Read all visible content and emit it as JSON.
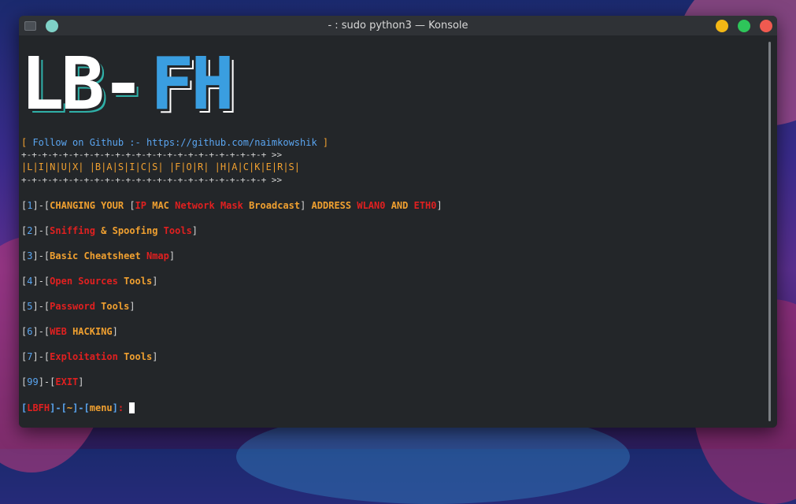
{
  "window": {
    "title": "- : sudo python3 — Konsole",
    "buttons": {
      "minimize_color": "#f3b715",
      "maximize_color": "#2ec55a",
      "close_color": "#f05a50"
    }
  },
  "logo": {
    "part1": "LB-",
    "part2": "FH",
    "white": "#ffffff",
    "blue": "#3a9ee0"
  },
  "follow": {
    "open": "[",
    "text": " Follow on Github :- https://github.com/naimkowshik ",
    "close": "]"
  },
  "banner": {
    "border": "+-+-+-+-+-+-+-+-+-+-+-+-+-+-+-+-+-+-+-+-+-+-+-+ >>",
    "text": "|L|I|N|U|X| |B|A|S|I|C|S| |F|O|R| |H|A|C|K|E|R|S|"
  },
  "menu": {
    "item1": {
      "num": "1",
      "a": "CHANGING YOUR ",
      "b": "IP",
      "c": " MAC ",
      "d": "Network",
      "e": " ",
      "f": "Mask",
      "g": " Broadcast",
      "h": " ADDRESS ",
      "i": "WLAN0",
      "j": " AND ",
      "k": "ETH0"
    },
    "item2": {
      "num": "2",
      "a": "Sniffing",
      "b": " & ",
      "c": "Spoofing",
      "d": " ",
      "e": "Tools"
    },
    "item3": {
      "num": "3",
      "a": "Basic Cheatsheet ",
      "b": "Nmap"
    },
    "item4": {
      "num": "4",
      "a": "Open Sources",
      "b": " Tools"
    },
    "item5": {
      "num": "5",
      "a": "Password",
      "b": " Tools"
    },
    "item6": {
      "num": "6",
      "a": "WEB",
      "b": " HACKING"
    },
    "item7": {
      "num": "7",
      "a": "Exploitation",
      "b": " Tools"
    },
    "item99": {
      "num": "99",
      "a": "EXIT"
    }
  },
  "prompt": {
    "host": "LBFH",
    "path": "~",
    "dir": "menu",
    "suffix": ": "
  }
}
